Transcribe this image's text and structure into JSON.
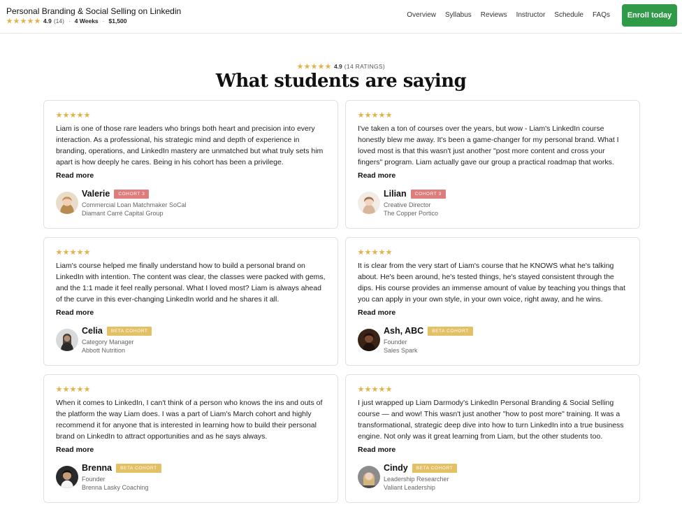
{
  "header": {
    "title": "Personal Branding & Social Selling on Linkedin",
    "rating": "4.9",
    "rating_count": "(14)",
    "duration": "4 Weeks",
    "price": "$1,500",
    "nav": [
      "Overview",
      "Syllabus",
      "Reviews",
      "Instructor",
      "Schedule",
      "FAQs"
    ],
    "cta": "Enroll today"
  },
  "summary": {
    "rating": "4.9",
    "count_label": "(14 RATINGS)",
    "stars": 5
  },
  "section_title": "What students are saying",
  "reviews": [
    {
      "text": "Liam is one of those rare leaders who brings both heart and precision into every interaction. As a professional, his strategic mind and depth of experience in branding, operations, and LinkedIn mastery are unmatched but what truly sets him apart is how deeply he cares. Being in his cohort has been a privilege.",
      "read_more": "Read more",
      "name": "Valerie",
      "badge": "COHORT 3",
      "role": "Commercial Loan Matchmaker SoCal",
      "company": "Diamant Carré Capital Group"
    },
    {
      "text": "I've taken a ton of courses over the years, but wow - Liam's LinkedIn course honestly blew me away. It's been a game-changer for my personal brand. What I loved most is that this wasn't just another \"post more content and cross your fingers\" program. Liam actually gave our group a practical roadmap that works.",
      "read_more": "Read more",
      "name": "Lilian",
      "badge": "COHORT 3",
      "role": "Creative Director",
      "company": "The Copper Portico"
    },
    {
      "text": "Liam's course helped me finally understand how to build a personal brand on LinkedIn with intention. The content was clear, the classes were packed with gems, and the 1:1 made it feel really personal. What I loved most? Liam is always ahead of the curve in this ever-changing LinkedIn world and he shares it all.",
      "read_more": "Read more",
      "name": "Celia",
      "badge": "BETA COHORT",
      "role": "Category Manager",
      "company": "Abbott Nutrition"
    },
    {
      "text": "It is clear from the very start of Liam's course that he KNOWS what he's talking about. He's been around, he's tested things, he's stayed consistent through the dips. His course provides an immense amount of value by teaching you things that you can apply in your own style, in your own voice, right away, and he wins.",
      "read_more": "Read more",
      "name": "Ash, ABC",
      "badge": "BETA COHORT",
      "role": "Founder",
      "company": "Sales Spark"
    },
    {
      "text": "When it comes to LinkedIn, I can't think of a person who knows the ins and outs of the platform the way Liam does. I was a part of Liam's March cohort and highly recommend it for anyone that is interested in learning how to build their personal brand on LinkedIn to attract opportunities and as he says always.",
      "read_more": "Read more",
      "name": "Brenna",
      "badge": "BETA COHORT",
      "role": "Founder",
      "company": "Brenna Lasky Coaching"
    },
    {
      "text": "I just wrapped up Liam Darmody's LinkedIn Personal Branding & Social Selling course — and wow! This wasn't just another \"how to post more\" training. It was a transformational, strategic deep dive into how to turn LinkedIn into a true business engine. Not only was it great learning from Liam, but the other students too.",
      "read_more": "Read more",
      "name": "Cindy",
      "badge": "BETA COHORT",
      "role": "Leadership Researcher",
      "company": "Valiant Leadership"
    }
  ],
  "colors": {
    "accent_green": "#2f9b48",
    "star_gold": "#e2b24a",
    "badge_red": "#df7d7a",
    "badge_gold": "#e4c065"
  }
}
